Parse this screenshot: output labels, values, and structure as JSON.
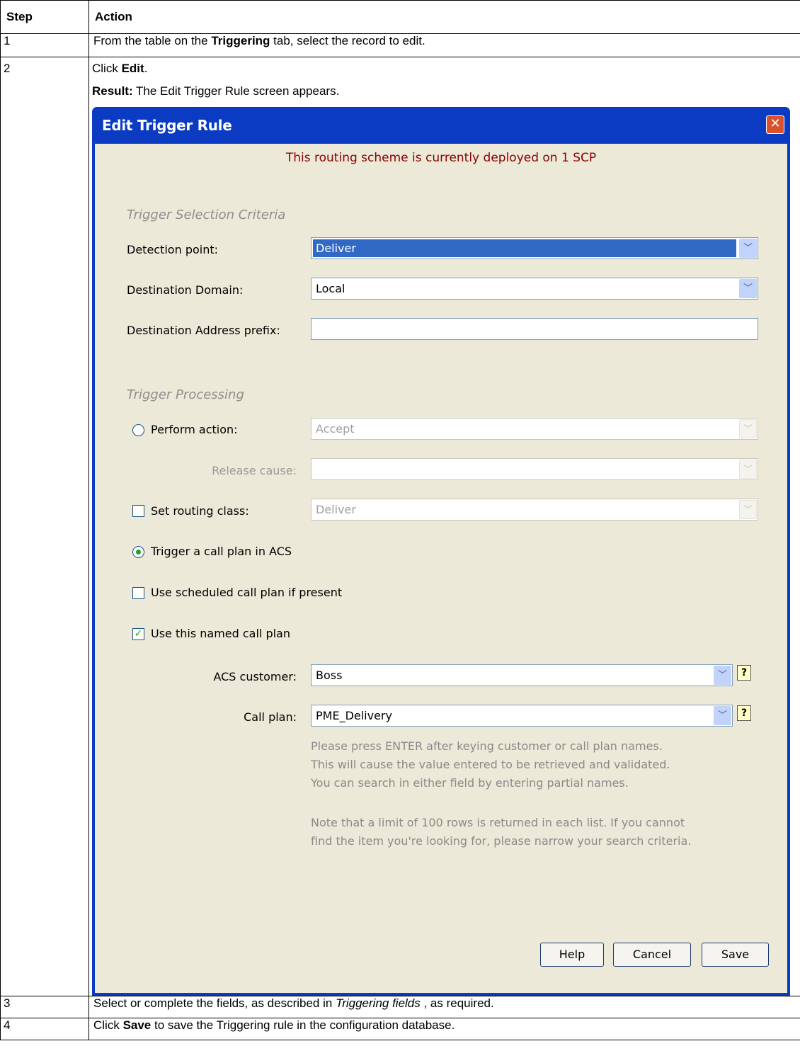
{
  "table": {
    "headers": {
      "step": "Step",
      "action": "Action"
    },
    "rows": [
      {
        "step": "1",
        "pre": "From the table on the ",
        "bold": "Triggering",
        "post": " tab, select the record to edit."
      },
      {
        "step": "2",
        "pre": "Click ",
        "bold": "Edit",
        "post": ".",
        "result_bold": "Result:",
        "result_text": " The Edit Trigger Rule screen appears."
      },
      {
        "step": "3",
        "pre": "Select or complete the fields, as described in ",
        "italic": "Triggering fields",
        "post": " , as required."
      },
      {
        "step": "4",
        "pre": "Click ",
        "bold": "Save",
        "post": " to save the Triggering rule in the configuration database."
      }
    ]
  },
  "dialog": {
    "title": "Edit Trigger Rule",
    "close_glyph": "✕",
    "notice": "This routing scheme is currently deployed on 1 SCP",
    "section_criteria": "Trigger Selection Criteria",
    "detection_point": {
      "label": "Detection point:",
      "value": "Deliver"
    },
    "destination_domain": {
      "label": "Destination Domain:",
      "value": "Local"
    },
    "destination_prefix": {
      "label": "Destination Address prefix:",
      "value": ""
    },
    "section_processing": "Trigger Processing",
    "perform_action": {
      "label": "Perform action:",
      "value": "Accept",
      "checked": false
    },
    "release_cause": {
      "label": "Release cause:",
      "value": ""
    },
    "set_routing_class": {
      "label": "Set routing class:",
      "value": "Deliver",
      "checked": false
    },
    "trigger_call_plan": {
      "label": "Trigger a call plan in ACS",
      "checked": true
    },
    "use_scheduled": {
      "label": "Use scheduled call plan if present",
      "checked": false
    },
    "use_named": {
      "label": "Use this named call plan",
      "checked": true
    },
    "acs_customer": {
      "label": "ACS customer:",
      "value": "Boss"
    },
    "call_plan": {
      "label": "Call plan:",
      "value": "PME_Delivery"
    },
    "help_glyph": "?",
    "dropdown_glyph": "﹀",
    "hint_lines": [
      "Please press ENTER after keying customer or call plan names.",
      "This will cause the value entered to be retrieved and validated.",
      "You can search in either field by entering partial names."
    ],
    "note_lines": [
      "Note that a limit of 100 rows is returned in each list. If you cannot",
      "find the item you're looking for, please narrow your search criteria."
    ],
    "buttons": {
      "help": "Help",
      "cancel": "Cancel",
      "save": "Save"
    },
    "colors": {
      "titlebar": "#0a3bc2",
      "client": "#ece9d8",
      "notice": "#8b0000",
      "selection": "#316ac5"
    }
  }
}
